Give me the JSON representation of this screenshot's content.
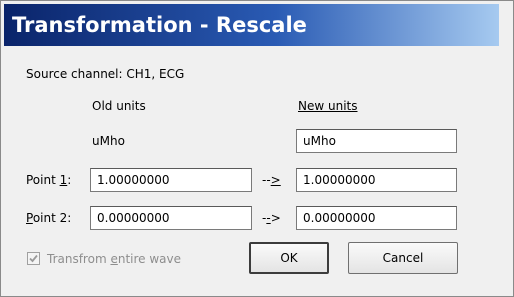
{
  "title": "Transformation - Rescale",
  "source": {
    "label": "Source channel:",
    "value": "CH1, ECG"
  },
  "columns": {
    "old_units": "Old units",
    "new_units": "New units"
  },
  "units": {
    "old_value": "uMho",
    "new_value": "uMho"
  },
  "point1": {
    "label_pre": "Point ",
    "label_acc": "1",
    "label_post": ":",
    "old_value": "1.00000000",
    "arrow_pre": "--",
    "arrow_acc": ">",
    "new_value": "1.00000000"
  },
  "point2": {
    "label_acc": "P",
    "label_post": "oint 2:",
    "old_value": "0.00000000",
    "arrow_pre": "-",
    "arrow_acc": "-",
    "arrow_post": ">",
    "new_value": "0.00000000"
  },
  "transform_entire": {
    "label_pre": "Transfrom ",
    "label_acc": "e",
    "label_post": "ntire wave",
    "checked": true,
    "enabled": false
  },
  "buttons": {
    "ok": "OK",
    "cancel": "Cancel"
  }
}
